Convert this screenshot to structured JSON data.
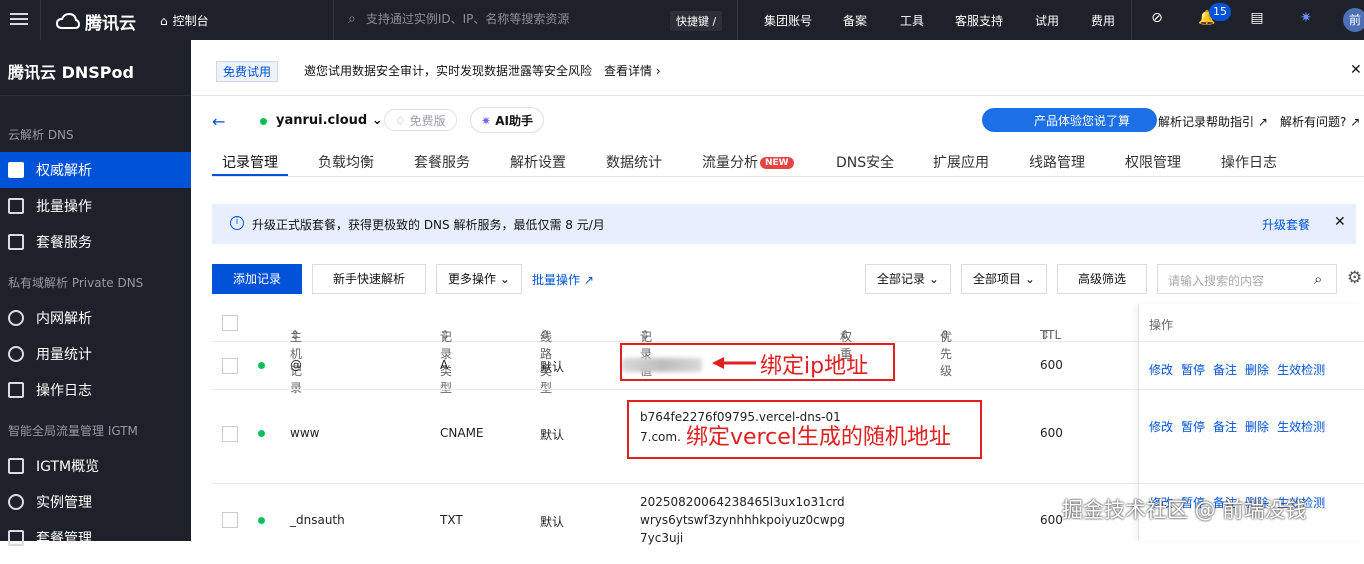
{
  "topbar": {
    "brand": "腾讯云",
    "console": "控制台",
    "search_placeholder": "支持通过实例ID、IP、名称等搜索资源",
    "shortcut": "快捷键 /",
    "nav": [
      "集团账号",
      "备案",
      "工具",
      "客服支持",
      "试用",
      "费用"
    ],
    "notification_count": "15",
    "avatar": "前"
  },
  "sidebar": {
    "product": "腾讯云 DNSPod",
    "sections": [
      {
        "title": "云解析 DNS",
        "items": [
          "权威解析",
          "批量操作",
          "套餐服务"
        ]
      },
      {
        "title": "私有域解析 Private DNS",
        "items": [
          "内网解析",
          "用量统计",
          "操作日志"
        ]
      },
      {
        "title": "智能全局流量管理 IGTM",
        "items": [
          "IGTM概览",
          "实例管理",
          "套餐管理"
        ]
      }
    ]
  },
  "notice": {
    "tag": "免费试用",
    "message": "邀您试用数据安全审计，实时发现数据泄露等安全风险",
    "more": "查看详情"
  },
  "header": {
    "domain": "yanrui.cloud",
    "plan": "免费版",
    "ai": "AI助手",
    "feedback": "产品体验您说了算",
    "help1": "解析记录帮助指引",
    "help2": "解析有问题?"
  },
  "tabs": [
    {
      "label": "记录管理",
      "active": true
    },
    {
      "label": "负载均衡"
    },
    {
      "label": "套餐服务"
    },
    {
      "label": "解析设置"
    },
    {
      "label": "数据统计"
    },
    {
      "label": "流量分析",
      "badge": "NEW"
    },
    {
      "label": "DNS安全"
    },
    {
      "label": "扩展应用"
    },
    {
      "label": "线路管理"
    },
    {
      "label": "权限管理"
    },
    {
      "label": "操作日志"
    }
  ],
  "info": {
    "text": "升级正式版套餐，获得更极致的 DNS 解析服务，最低仅需 8 元/月",
    "link": "升级套餐"
  },
  "toolbar": {
    "add": "添加记录",
    "quick": "新手快速解析",
    "more": "更多操作",
    "batch": "批量操作",
    "filter_all": "全部记录",
    "filter_items": "全部项目",
    "advanced": "高级筛选",
    "search_placeholder": "请输入搜索的内容"
  },
  "table": {
    "headers": [
      "主机记录",
      "记录类型",
      "线路类型",
      "记录值",
      "权重",
      "优先级",
      "TTL",
      "操作"
    ],
    "rows": [
      {
        "host": "@",
        "type": "A",
        "line": "默认",
        "value": "",
        "ttl": "600"
      },
      {
        "host": "www",
        "type": "CNAME",
        "line": "默认",
        "value_lines": [
          "b764fe2276f09795.vercel-dns-01",
          "7.com."
        ],
        "ttl": "600"
      },
      {
        "host": "_dnsauth",
        "type": "TXT",
        "line": "默认",
        "value_lines": [
          "20250820064238465l3ux1o31crd",
          "wrys6ytswf3zynhhhkpoiyuz0cwpg",
          "7yc3uji"
        ],
        "ttl": "600"
      }
    ],
    "actions": [
      "修改",
      "暂停",
      "备注",
      "删除",
      "生效检测"
    ]
  },
  "annotations": {
    "ip": "绑定ip地址",
    "vercel": "绑定vercel生成的随机地址"
  },
  "watermark": "掘金技术社区 @ 前端没钱"
}
